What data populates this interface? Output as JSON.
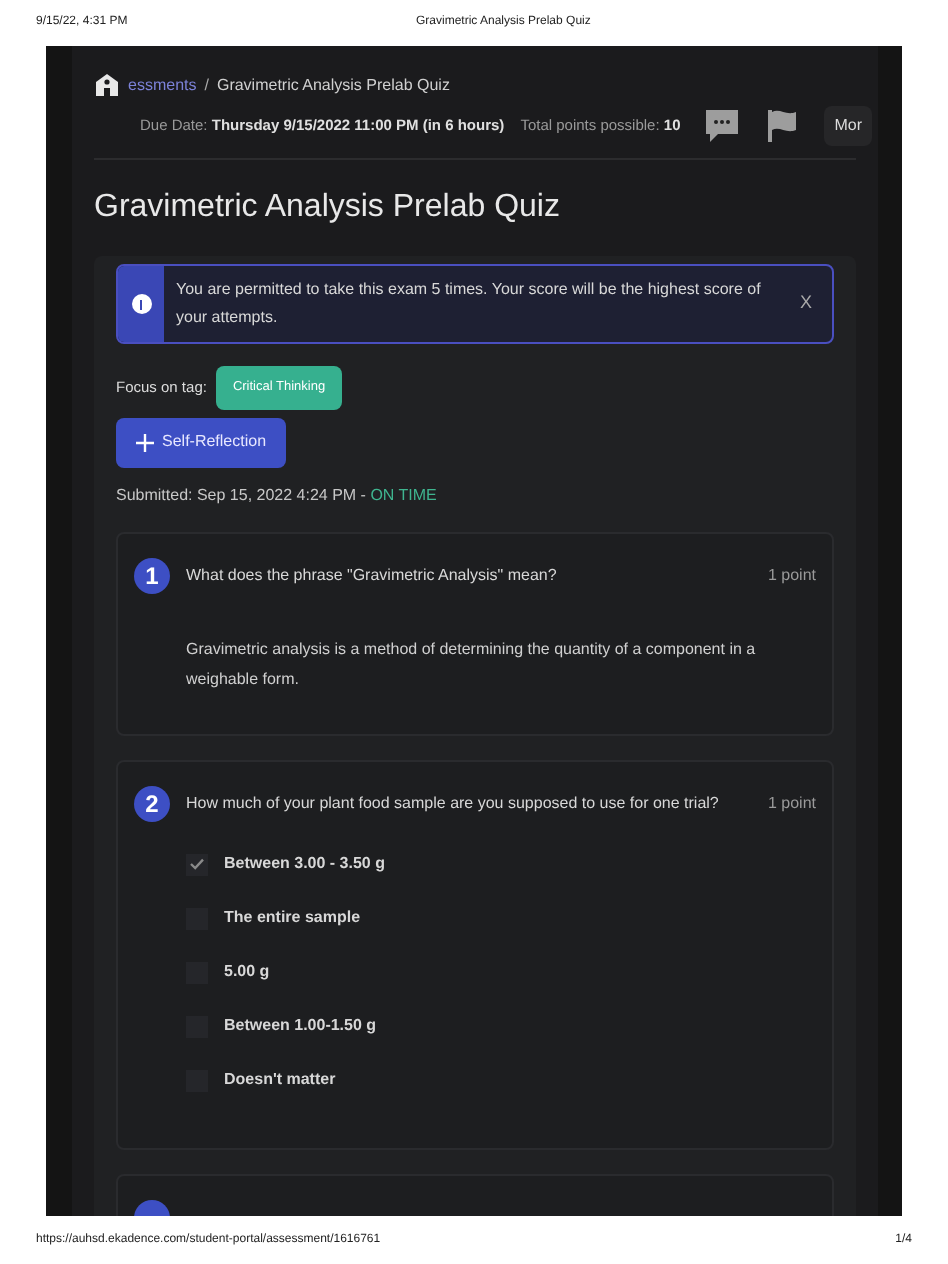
{
  "print_header": {
    "date": "9/15/22, 4:31 PM",
    "title": "Gravimetric Analysis Prelab Quiz"
  },
  "breadcrumb": [
    {
      "label": "essments"
    },
    {
      "label": "Gravimetric Analysis Prelab Quiz"
    }
  ],
  "breadcrumb_separator": "/",
  "due": {
    "label": "Due Date:",
    "value": "Thursday 9/15/2022 11:00 PM (in 6 hours)"
  },
  "points": {
    "label": "Total points possible:",
    "value": "10"
  },
  "more_button": "Mor",
  "page_title": "Gravimetric Analysis Prelab Quiz",
  "alert": {
    "text": "You are permitted to take this exam 5 times. Your score will be the highest score of your attempts.",
    "close": "X"
  },
  "focus": {
    "label": "Focus on tag:",
    "tag": "Critical Thinking"
  },
  "self_reflection_button": "Self-Reflection",
  "submitted": {
    "text": "Submitted: Sep 15, 2022 4:24 PM - ",
    "status": "ON TIME"
  },
  "questions": [
    {
      "kind": "text",
      "number": "1",
      "prompt": "What does the phrase \"Gravimetric Analysis\" mean?",
      "points": "1 point",
      "answer": "Gravimetric analysis is a method of determining the quantity of a component in a weighable form."
    },
    {
      "kind": "choice",
      "number": "2",
      "prompt": "How much of your plant food sample are you supposed to use for one trial?",
      "points": "1 point",
      "options": [
        {
          "label": "Between 3.00 - 3.50 g",
          "checked": true
        },
        {
          "label": "The entire sample",
          "checked": false
        },
        {
          "label": "5.00 g",
          "checked": false
        },
        {
          "label": "Between 1.00-1.50 g",
          "checked": false
        },
        {
          "label": "Doesn't matter",
          "checked": false
        }
      ]
    },
    {
      "kind": "cut"
    }
  ],
  "print_footer": {
    "url": "https://auhsd.ekadence.com/student-portal/assessment/1616761",
    "page": "1/4"
  }
}
